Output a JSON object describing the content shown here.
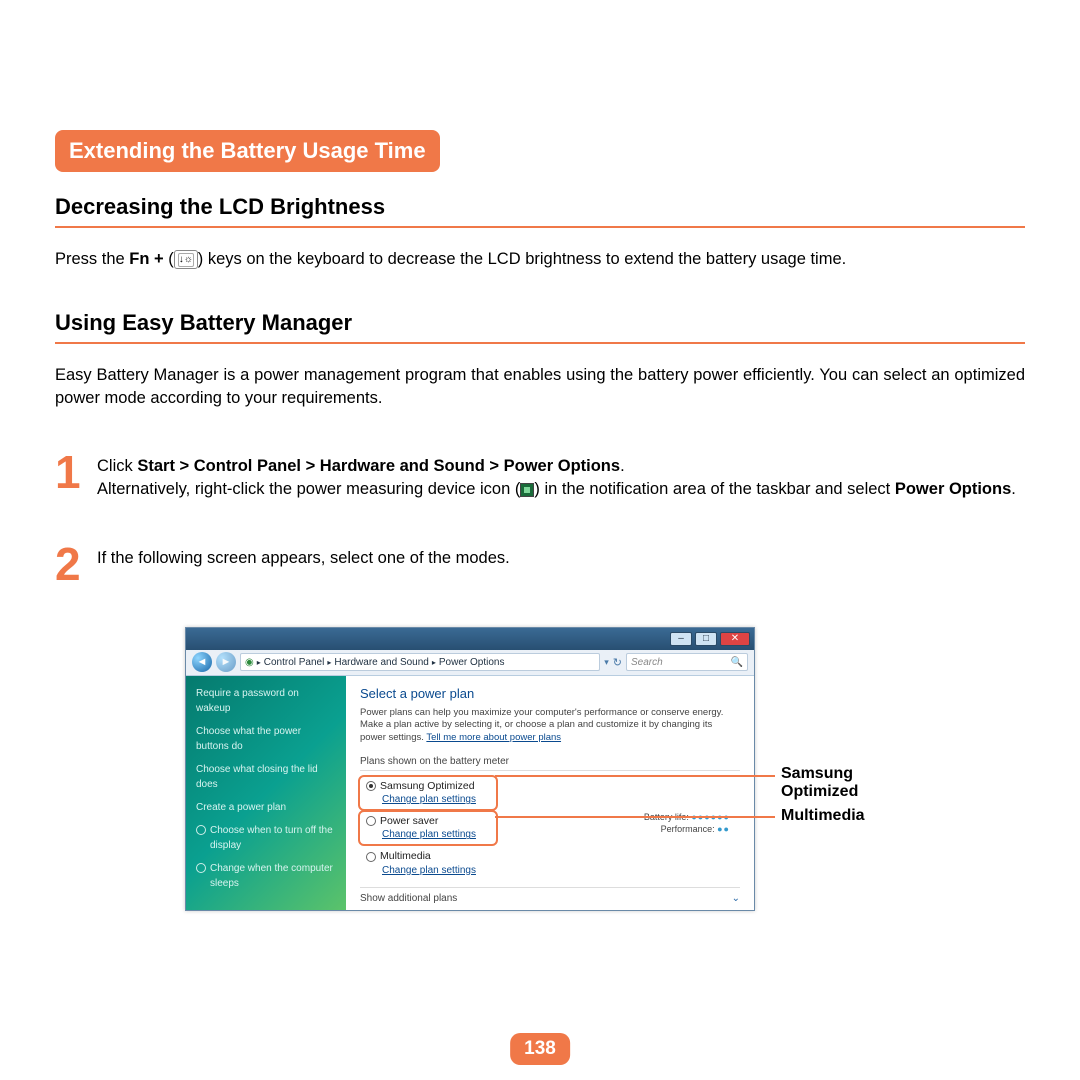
{
  "page": {
    "section_title": "Extending the Battery Usage Time",
    "sub1": "Decreasing the LCD Brightness",
    "para1_a": "Press the ",
    "para1_fn": "Fn + ",
    "para1_b": " keys on the keyboard to decrease the LCD brightness to extend the battery usage time.",
    "sub2": "Using Easy Battery Manager",
    "para2": "Easy Battery Manager is a power management program that enables using the battery power efficiently. You can select an optimized power mode according to your requirements.",
    "step1_num": "1",
    "step1_a": "Click ",
    "step1_path": "Start > Control Panel > Hardware and Sound > Power Options",
    "step1_b": ".",
    "step1_c": "Alternatively, right-click the power measuring device icon (",
    "step1_d": ") in the notification area of the taskbar and select ",
    "step1_po": "Power Options",
    "step1_e": ".",
    "step2_num": "2",
    "step2": "If the following screen appears, select one of the modes.",
    "page_num": "138"
  },
  "callouts": {
    "c1": "Samsung Optimized",
    "c2": "Multimedia"
  },
  "vista": {
    "crumb1": "Control Panel",
    "crumb2": "Hardware and Sound",
    "crumb3": "Power Options",
    "search_ph": "Search",
    "side": {
      "s1": "Require a password on wakeup",
      "s2": "Choose what the power buttons do",
      "s3": "Choose what closing the lid does",
      "s4": "Create a power plan",
      "s5": "Choose when to turn off the display",
      "s6": "Change when the computer sleeps"
    },
    "main": {
      "h": "Select a power plan",
      "p1": "Power plans can help you maximize your computer's performance or conserve energy. Make a plan active by selecting it, or choose a plan and customize it by changing its power settings. ",
      "tell": "Tell me more about power plans",
      "plans_head": "Plans shown on the battery meter",
      "plan1": "Samsung Optimized",
      "plan2": "Power saver",
      "plan3": "Multimedia",
      "change": "Change plan settings",
      "battery_life": "Battery life:",
      "perf": "Performance:",
      "addl": "Show additional plans"
    }
  }
}
